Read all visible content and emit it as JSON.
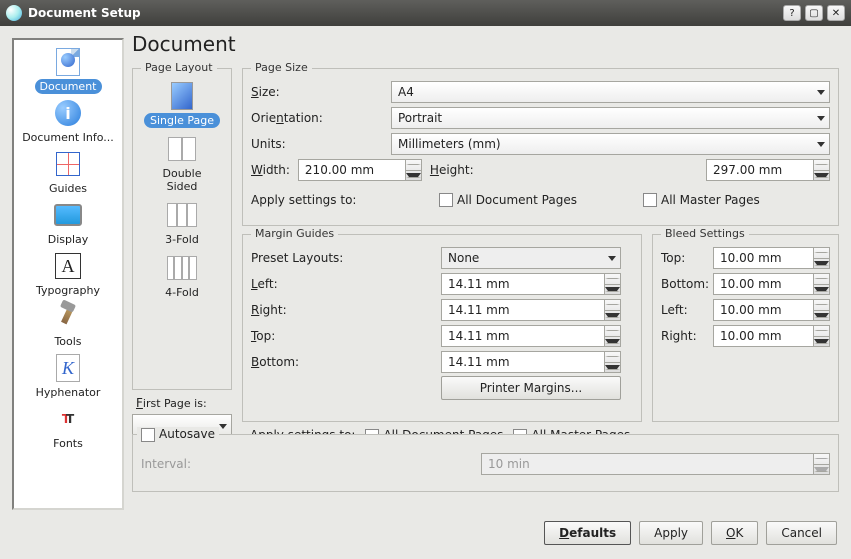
{
  "titlebar": {
    "title": "Document Setup"
  },
  "nav": {
    "items": [
      {
        "label": "Document"
      },
      {
        "label": "Document Info..."
      },
      {
        "label": "Guides"
      },
      {
        "label": "Display"
      },
      {
        "label": "Typography"
      },
      {
        "label": "Tools"
      },
      {
        "label": "Hyphenator"
      },
      {
        "label": "Fonts"
      }
    ],
    "selected": 0
  },
  "main": {
    "title": "Document"
  },
  "pageLayout": {
    "legend": "Page Layout",
    "items": [
      {
        "label": "Single Page"
      },
      {
        "label": "Double Sided"
      },
      {
        "label": "3-Fold"
      },
      {
        "label": "4-Fold"
      }
    ],
    "selected": 0,
    "firstPageLabel": "First Page is:",
    "firstPageValue": ""
  },
  "pageSize": {
    "legend": "Page Size",
    "sizeLabel": "Size:",
    "sizeValue": "A4",
    "orientationLabel": "Orientation:",
    "orientationValue": "Portrait",
    "unitsLabel": "Units:",
    "unitsValue": "Millimeters (mm)",
    "widthLabel": "Width:",
    "widthValue": "210.00 mm",
    "heightLabel": "Height:",
    "heightValue": "297.00 mm",
    "applyLabel": "Apply settings to:",
    "allDocPages": "All Document Pages",
    "allMasterPages": "All Master Pages"
  },
  "margins": {
    "legend": "Margin Guides",
    "presetLabel": "Preset Layouts:",
    "presetValue": "None",
    "leftLabel": "Left:",
    "leftValue": "14.11 mm",
    "rightLabel": "Right:",
    "rightValue": "14.11 mm",
    "topLabel": "Top:",
    "topValue": "14.11 mm",
    "bottomLabel": "Bottom:",
    "bottomValue": "14.11 mm",
    "printerBtn": "Printer Margins...",
    "applyLabel": "Apply settings to:",
    "allDocPages": "All Document Pages",
    "allMasterPages": "All Master Pages"
  },
  "bleed": {
    "legend": "Bleed Settings",
    "topLabel": "Top:",
    "topValue": "10.00 mm",
    "bottomLabel": "Bottom:",
    "bottomValue": "10.00 mm",
    "leftLabel": "Left:",
    "leftValue": "10.00 mm",
    "rightLabel": "Right:",
    "rightValue": "10.00 mm"
  },
  "autosave": {
    "legend": "Autosave",
    "intervalLabel": "Interval:",
    "intervalValue": "10 min"
  },
  "buttons": {
    "defaults": "Defaults",
    "apply": "Apply",
    "ok": "OK",
    "cancel": "Cancel"
  }
}
